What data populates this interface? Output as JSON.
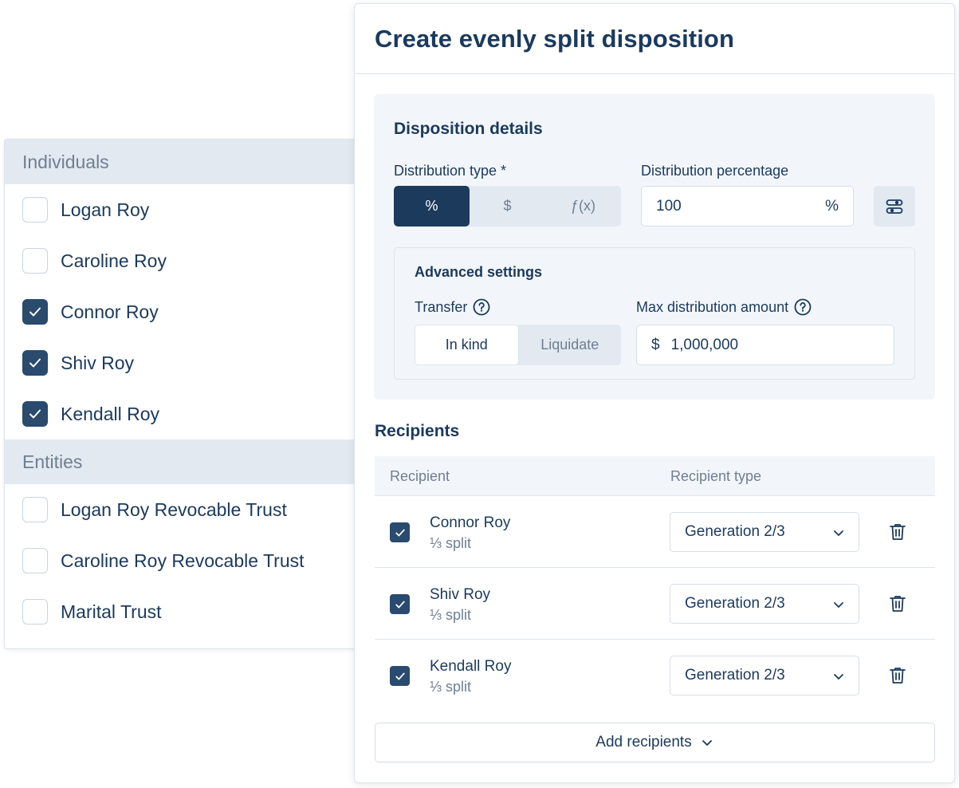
{
  "left_panel": {
    "groups": [
      {
        "header": "Individuals",
        "items": [
          {
            "label": "Logan Roy",
            "checked": false
          },
          {
            "label": "Caroline Roy",
            "checked": false
          },
          {
            "label": "Connor Roy",
            "checked": true
          },
          {
            "label": "Shiv Roy",
            "checked": true
          },
          {
            "label": "Kendall Roy",
            "checked": true
          }
        ]
      },
      {
        "header": "Entities",
        "items": [
          {
            "label": "Logan Roy Revocable Trust",
            "checked": false
          },
          {
            "label": "Caroline Roy Revocable Trust",
            "checked": false
          },
          {
            "label": "Marital Trust",
            "checked": false
          }
        ]
      }
    ]
  },
  "card": {
    "title": "Create evenly split disposition",
    "details": {
      "title": "Disposition details",
      "distribution_type": {
        "label": "Distribution type *",
        "options": [
          "%",
          "$",
          "ƒ(x)"
        ],
        "selected": "%"
      },
      "distribution_percentage": {
        "label": "Distribution percentage",
        "value": "100",
        "suffix": "%"
      },
      "settings_icon": "sliders-icon",
      "advanced": {
        "title": "Advanced settings",
        "transfer": {
          "label": "Transfer",
          "options": [
            "In kind",
            "Liquidate"
          ],
          "selected": "In kind"
        },
        "max_amount": {
          "label": "Max distribution amount",
          "prefix": "$",
          "value": "1,000,000"
        }
      }
    },
    "recipients": {
      "title": "Recipients",
      "columns": [
        "Recipient",
        "Recipient type"
      ],
      "rows": [
        {
          "name": "Connor Roy",
          "split": "⅓ split",
          "type": "Generation 2/3",
          "checked": true
        },
        {
          "name": "Shiv Roy",
          "split": "⅓ split",
          "type": "Generation 2/3",
          "checked": true
        },
        {
          "name": "Kendall Roy",
          "split": "⅓ split",
          "type": "Generation 2/3",
          "checked": true
        }
      ],
      "add_button": "Add recipients"
    }
  },
  "colors": {
    "navy": "#1b3a5c",
    "checkbox": "#2a4a6e",
    "muted_text": "#6f7f91",
    "panel_bg": "#f2f6fa",
    "header_bg": "#e2e9f1"
  }
}
